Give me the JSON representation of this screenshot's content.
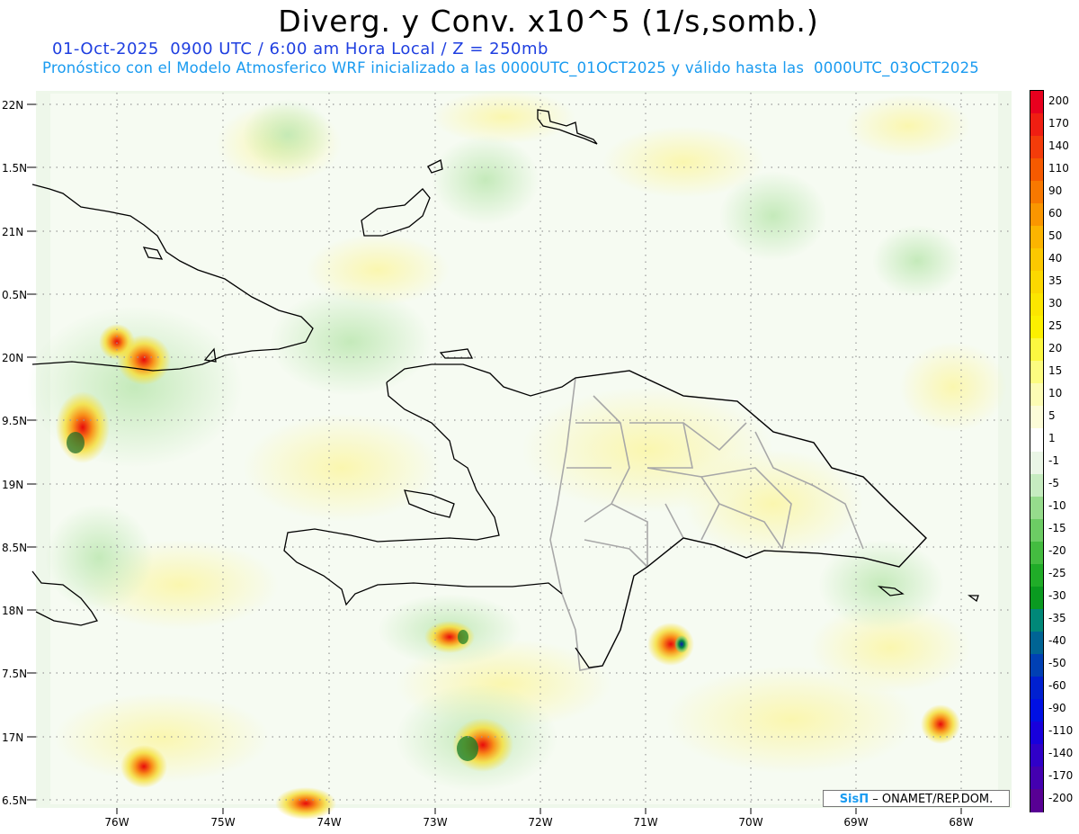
{
  "title": "Diverg. y Conv. x10^5 (1/s,somb.)",
  "subtitle_line1": "01-Oct-2025  0900 UTC / 6:00 am Hora Local / Z = 250mb",
  "subtitle_line2": "Pronóstico con el Modelo Atmosferico WRF inicializado a las 0000UTC_01OCT2025 y válido hasta las  0000UTC_03OCT2025",
  "credit": {
    "brand": "SisΠ",
    "text": "– ONAMET/REP.DOM."
  },
  "axes": {
    "lat_labels": [
      "22N",
      "1.5N",
      "21N",
      "0.5N",
      "20N",
      "9.5N",
      "19N",
      "8.5N",
      "18N",
      "7.5N",
      "17N",
      "6.5N"
    ],
    "lon_labels": [
      "76W",
      "75W",
      "74W",
      "73W",
      "72W",
      "71W",
      "70W",
      "69W",
      "68W"
    ],
    "lat_range": [
      16.5,
      22.0
    ],
    "lon_range": [
      -76.6,
      -67.6
    ]
  },
  "colorbar": {
    "labels": [
      "200",
      "170",
      "140",
      "110",
      "90",
      "60",
      "50",
      "40",
      "35",
      "30",
      "25",
      "20",
      "15",
      "10",
      "5",
      "1",
      "-1",
      "-5",
      "-10",
      "-15",
      "-20",
      "-25",
      "-30",
      "-35",
      "-40",
      "-50",
      "-60",
      "-90",
      "-110",
      "-140",
      "-170",
      "-200"
    ],
    "colors": [
      "#e8001e",
      "#f01e12",
      "#f43c0a",
      "#f65a00",
      "#f87800",
      "#fa9600",
      "#fcb400",
      "#fcc800",
      "#fcd800",
      "#fce600",
      "#fcf000",
      "#fcf840",
      "#fcfc80",
      "#fcfcb4",
      "#fcfcd8",
      "#ffffff",
      "#eaf6e6",
      "#c6ecc0",
      "#96dc8c",
      "#6ccc64",
      "#44bc40",
      "#20ac28",
      "#0a9a20",
      "#008878",
      "#006494",
      "#0040b4",
      "#0020d0",
      "#0010e4",
      "#1800dc",
      "#3000c8",
      "#4400b0",
      "#580094"
    ]
  }
}
